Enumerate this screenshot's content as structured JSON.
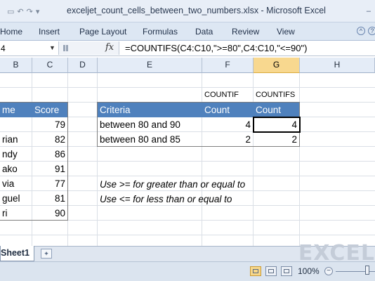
{
  "window": {
    "title": "exceljet_count_cells_between_two_numbers.xlsx - Microsoft Excel",
    "minimize_glyph": "–"
  },
  "ribbon": {
    "tabs": [
      "Home",
      "Insert",
      "Page Layout",
      "Formulas",
      "Data",
      "Review",
      "View"
    ],
    "help_icon": "question-icon"
  },
  "formula_bar": {
    "name_box": "4",
    "fx_label": "fx",
    "formula": "=COUNTIFS(C4:C10,\">=80\",C4:C10,\"<=90\")"
  },
  "columns": [
    "B",
    "C",
    "D",
    "E",
    "F",
    "G",
    "H"
  ],
  "selected_column": "G",
  "names_table": {
    "header_name": "me",
    "header_score": "Score",
    "rows": [
      {
        "name": "",
        "score": "79"
      },
      {
        "name": "rian",
        "score": "82"
      },
      {
        "name": "ndy",
        "score": "86"
      },
      {
        "name": "ako",
        "score": "91"
      },
      {
        "name": "via",
        "score": "77"
      },
      {
        "name": "guel",
        "score": "81"
      },
      {
        "name": "ri",
        "score": "90"
      }
    ]
  },
  "criteria_table": {
    "label_countif": "COUNTIF",
    "label_countifs": "COUNTIFS",
    "header_criteria": "Criteria",
    "header_count_f": "Count",
    "header_count_g": "Count",
    "rows": [
      {
        "criteria": "between 80 and 90",
        "countif": "4",
        "countifs": "4"
      },
      {
        "criteria": "between 80 and 85",
        "countif": "2",
        "countifs": "2"
      }
    ]
  },
  "notes": [
    "Use >= for greater than or equal to",
    "Use <= for less than or equal to"
  ],
  "sheet_tabs": {
    "active": "Sheet1",
    "watermark": "EXCEL"
  },
  "status_bar": {
    "zoom_label": "100%",
    "zoom_out": "−",
    "zoom_percent": 100
  },
  "colors": {
    "table_header": "#4f81bd",
    "selected_column_header": "#f8d88f"
  }
}
